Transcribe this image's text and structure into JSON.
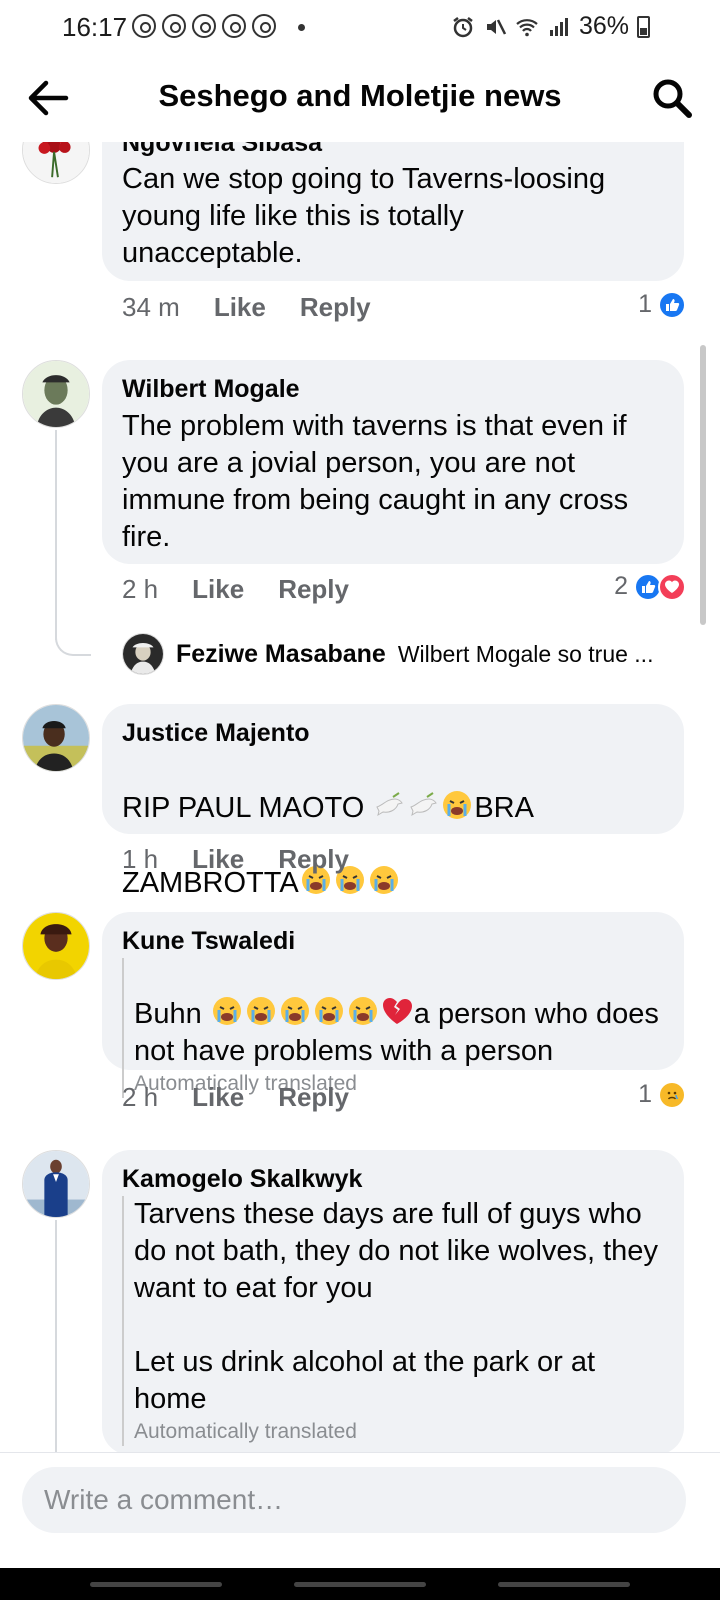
{
  "status_bar": {
    "time": "16:17",
    "battery": "36%",
    "notification_count": 5
  },
  "header": {
    "title": "Seshego and Moletjie news"
  },
  "comments": [
    {
      "author": "Ngovhela Sibasa",
      "text": "Can we stop going to Taverns-loosing young life  like this is totally unacceptable.",
      "time": "34 m",
      "like_label": "Like",
      "reply_label": "Reply",
      "reaction_count": "1",
      "reactions": [
        "like"
      ]
    },
    {
      "author": "Wilbert Mogale",
      "text": "The problem with taverns is that even if you are a jovial person, you are not immune from being caught in any cross fire.",
      "time": "2 h",
      "like_label": "Like",
      "reply_label": "Reply",
      "reaction_count": "2",
      "reactions": [
        "like",
        "love"
      ],
      "reply_preview": {
        "author": "Feziwe Masabane",
        "text": "Wilbert Mogale so true ..."
      }
    },
    {
      "author": "Justice Majento",
      "text_part1": "RIP PAUL MAOTO ",
      "text_part2": "BRA",
      "text_part3": "ZAMBROTTA",
      "time": "1 h",
      "like_label": "Like",
      "reply_label": "Reply"
    },
    {
      "author": "Kune Tswaledi",
      "text_part1": "Buhn ",
      "text_part2": "a person who does not have problems with a person",
      "auto_translated": "Automatically translated",
      "time": "2 h",
      "like_label": "Like",
      "reply_label": "Reply",
      "reaction_count": "1",
      "reactions": [
        "sad"
      ]
    },
    {
      "author": "Kamogelo Skalkwyk",
      "text": "Tarvens these days are full of guys who do not bath, they do not like wolves, they want to eat for you\n\nLet us drink alcohol at the park or at home",
      "auto_translated": "Automatically translated"
    }
  ],
  "composer": {
    "placeholder": "Write a comment…"
  },
  "colors": {
    "like_blue": "#1877f2",
    "love_red": "#f33e58",
    "sad_yellow": "#f7b928",
    "bubble_bg": "#f0f2f5",
    "meta_grey": "#65676b"
  }
}
